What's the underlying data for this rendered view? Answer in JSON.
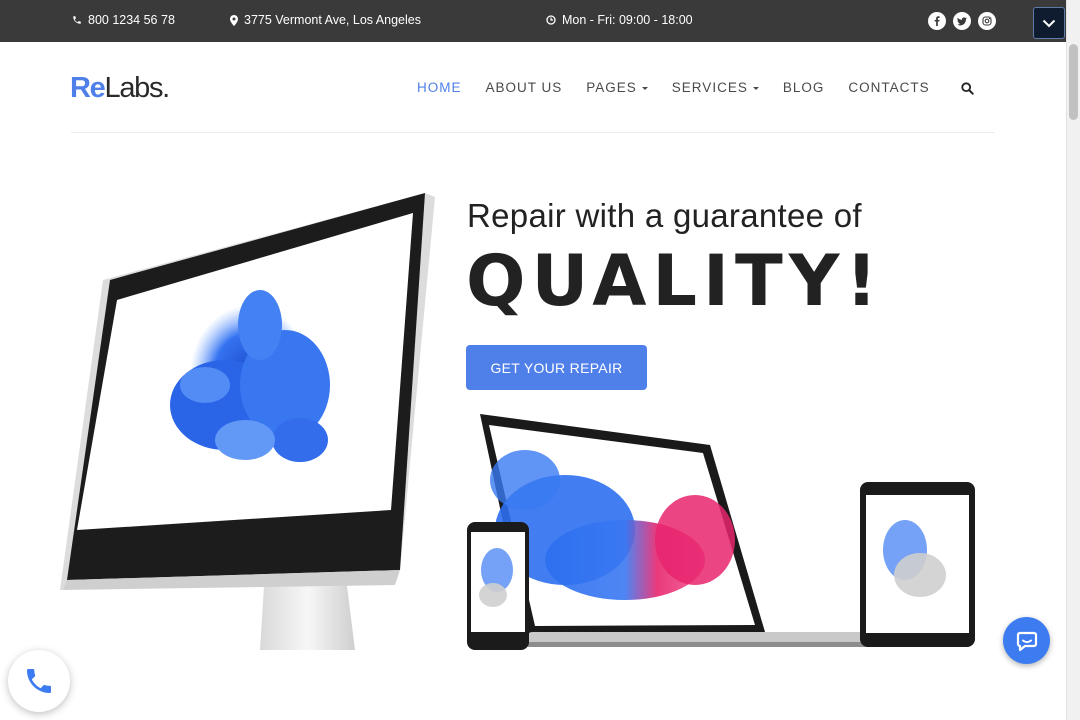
{
  "topbar": {
    "phone": "800 1234 56 78",
    "address": "3775 Vermont Ave, Los Angeles",
    "hours": "Mon - Fri: 09:00 - 18:00",
    "social": [
      "facebook-icon",
      "twitter-icon",
      "instagram-icon"
    ],
    "background": "#3a3a3a"
  },
  "logo": {
    "part1": "Re",
    "part2": "Labs",
    "dot": "."
  },
  "nav": {
    "items": [
      {
        "label": "HOME",
        "active": true,
        "dropdown": false
      },
      {
        "label": "ABOUT US",
        "active": false,
        "dropdown": false
      },
      {
        "label": "PAGES",
        "active": false,
        "dropdown": true
      },
      {
        "label": "SERVICES",
        "active": false,
        "dropdown": true
      },
      {
        "label": "BLOG",
        "active": false,
        "dropdown": false
      },
      {
        "label": "CONTACTS",
        "active": false,
        "dropdown": false
      }
    ],
    "search_icon": "search-icon"
  },
  "hero": {
    "line1": "Repair with a guarantee of",
    "line2": "QUALITY!",
    "cta": "GET YOUR REPAIR"
  },
  "colors": {
    "accent": "#4f7fe8",
    "text": "#222222",
    "chat": "#3d7cf0"
  },
  "widgets": {
    "call_icon": "phone-icon",
    "chat_icon": "chat-icon"
  }
}
